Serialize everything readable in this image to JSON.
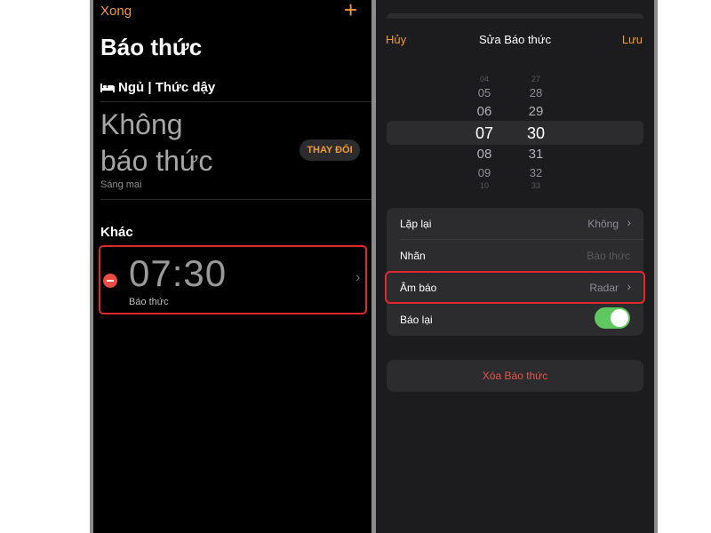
{
  "left": {
    "done_label": "Xong",
    "add_label": "+",
    "title": "Báo thức",
    "sleep_section": "Ngủ | Thức dậy",
    "no_alarm_line1": "Không",
    "no_alarm_line2": "báo thức",
    "tomorrow": "Sáng mai",
    "change_label": "THAY ĐỔI",
    "other_section": "Khác",
    "alarm": {
      "time": "07:30",
      "label": "Báo thức"
    },
    "chevron": "›"
  },
  "right": {
    "cancel_label": "Hủy",
    "title": "Sửa Báo thức",
    "save_label": "Lưu",
    "picker": {
      "hours": [
        "04",
        "05",
        "06",
        "07",
        "08",
        "09",
        "10"
      ],
      "minutes": [
        "27",
        "28",
        "29",
        "30",
        "31",
        "32",
        "33"
      ],
      "selected_hour": "07",
      "selected_minute": "30"
    },
    "settings": {
      "repeat": {
        "label": "Lặp lại",
        "value": "Không"
      },
      "name": {
        "label": "Nhãn",
        "placeholder": "Báo thức"
      },
      "sound": {
        "label": "Âm báo",
        "value": "Radar"
      },
      "snooze": {
        "label": "Báo lại",
        "on": true
      }
    },
    "chevron": "›",
    "delete_label": "Xóa Báo thức"
  },
  "colors": {
    "accent": "#f09a37",
    "highlight_border": "#e0282e",
    "toggle_on": "#5fc760",
    "destructive": "#e5534b"
  }
}
